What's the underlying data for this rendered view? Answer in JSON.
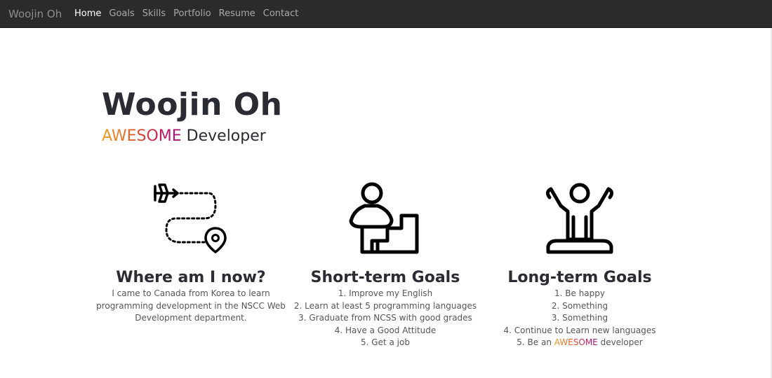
{
  "navbar": {
    "brand": "Woojin Oh",
    "links": [
      {
        "label": "Home"
      },
      {
        "label": "Goals"
      },
      {
        "label": "Skills"
      },
      {
        "label": "Portfolio"
      },
      {
        "label": "Resume"
      },
      {
        "label": "Contact"
      }
    ],
    "active_index": 0
  },
  "hero": {
    "name": "Woojin Oh",
    "subtitle_highlight": "AWESOME",
    "subtitle_rest": " Developer"
  },
  "columns": [
    {
      "icon": "route-plane-to-pin-icon",
      "title": "Where am I now?",
      "text": "I came to Canada from Korea to learn programming development in the NSCC Web Development department."
    },
    {
      "icon": "person-climbing-stairs-icon",
      "title": "Short-term Goals",
      "items": [
        "1. Improve my English",
        "2. Learn at least 5 programming languages",
        "3. Graduate from NCSS with good grades",
        "4. Have a Good Attitude",
        "5. Get a job"
      ]
    },
    {
      "icon": "person-arms-raised-podium-icon",
      "title": "Long-term Goals",
      "items": [
        "1. Be happy",
        "2. Something",
        "3. Something",
        "4. Continue to Learn new languages"
      ],
      "last_item_prefix": "5. Be an ",
      "last_item_highlight": "AWESOME",
      "last_item_suffix": " developer"
    }
  ],
  "colors": {
    "navbar_bg": "#2b2b2b",
    "text_dark": "#2b2b33",
    "awesome_gradient": [
      "#f0a020",
      "#e0502a",
      "#c4175e",
      "#a2157a"
    ]
  }
}
